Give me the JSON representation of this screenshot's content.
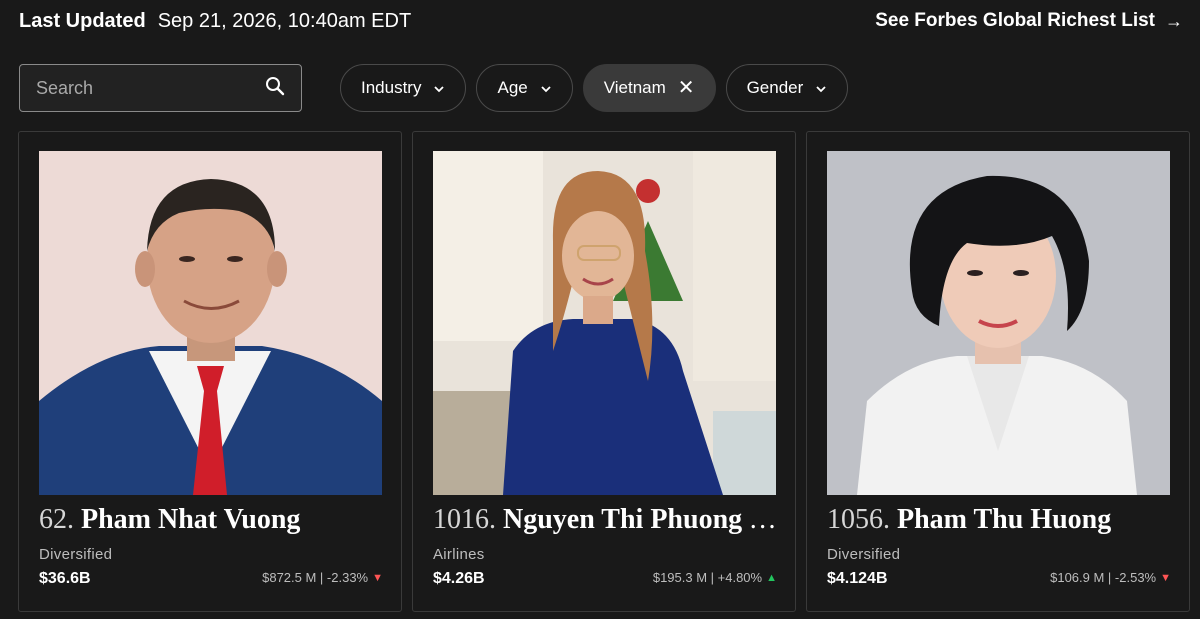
{
  "header": {
    "last_updated_label": "Last Updated",
    "last_updated_value": "Sep 21, 2026, 10:40am EDT",
    "richest_link": "See Forbes Global Richest List",
    "arrow_icon": "arrow-right-icon"
  },
  "filters": {
    "search_placeholder": "Search",
    "industry": "Industry",
    "age": "Age",
    "country": "Vietnam",
    "gender": "Gender"
  },
  "cards": [
    {
      "rank": "62.",
      "name": "Pham Nhat Vuong",
      "industry": "Diversified",
      "net_worth": "$36.6B",
      "change": "$872.5 M | -2.33%",
      "trend": "down"
    },
    {
      "rank": "1016.",
      "name": "Nguyen Thi Phuong Thao",
      "industry": "Airlines",
      "net_worth": "$4.26B",
      "change": "$195.3 M | +4.80%",
      "trend": "up"
    },
    {
      "rank": "1056.",
      "name": "Pham Thu Huong",
      "industry": "Diversified",
      "net_worth": "$4.124B",
      "change": "$106.9 M | -2.53%",
      "trend": "down"
    }
  ],
  "colors": {
    "background": "#191919",
    "down": "#ff5555",
    "up": "#22c55e"
  }
}
